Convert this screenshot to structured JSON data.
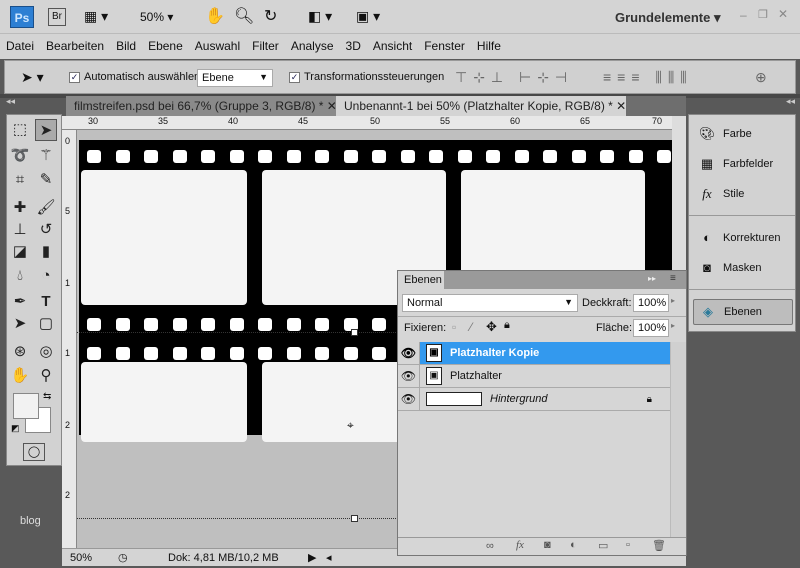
{
  "app": {
    "logo": "Ps",
    "bridge": "Br",
    "zoom": "50%",
    "workspace": "Grundelemente"
  },
  "menu": [
    "Datei",
    "Bearbeiten",
    "Bild",
    "Ebene",
    "Auswahl",
    "Filter",
    "Analyse",
    "3D",
    "Ansicht",
    "Fenster",
    "Hilfe"
  ],
  "options": {
    "auto_select_label": "Automatisch auswählen:",
    "auto_select_value": "Ebene",
    "transform_label": "Transformationssteuerungen"
  },
  "tabs": [
    {
      "label": "filmstreifen.psd bei 66,7% (Gruppe 3, RGB/8) *",
      "active": false
    },
    {
      "label": "Unbenannt-1 bei 50% (Platzhalter Kopie, RGB/8) *",
      "active": true
    }
  ],
  "ruler_h": [
    "30",
    "35",
    "40",
    "45",
    "50",
    "55",
    "60",
    "65",
    "70"
  ],
  "ruler_v": [
    "0",
    "5",
    "1",
    "1",
    "2",
    "2"
  ],
  "status": {
    "zoom": "50%",
    "doc": "Dok: 4,81 MB/10,2 MB"
  },
  "side_label": "blog",
  "dock": [
    {
      "label": "Farbe",
      "icon": "color-icon"
    },
    {
      "label": "Farbfelder",
      "icon": "swatches-icon"
    },
    {
      "label": "Stile",
      "icon": "styles-icon"
    },
    {
      "label": "Korrekturen",
      "icon": "adjustments-icon"
    },
    {
      "label": "Masken",
      "icon": "masks-icon"
    },
    {
      "label": "Ebenen",
      "icon": "layers-icon"
    }
  ],
  "layers_panel": {
    "title": "Ebenen",
    "blend_mode": "Normal",
    "opacity_label": "Deckkraft:",
    "opacity": "100%",
    "lock_label": "Fixieren:",
    "fill_label": "Fläche:",
    "fill": "100%",
    "layers": [
      {
        "name": "Platzhalter Kopie",
        "selected": true
      },
      {
        "name": "Platzhalter",
        "selected": false
      },
      {
        "name": "Hintergrund",
        "selected": false,
        "locked": true
      }
    ]
  },
  "colors": {
    "selection": "#3399ee",
    "chrome": "#d4d4d4"
  }
}
